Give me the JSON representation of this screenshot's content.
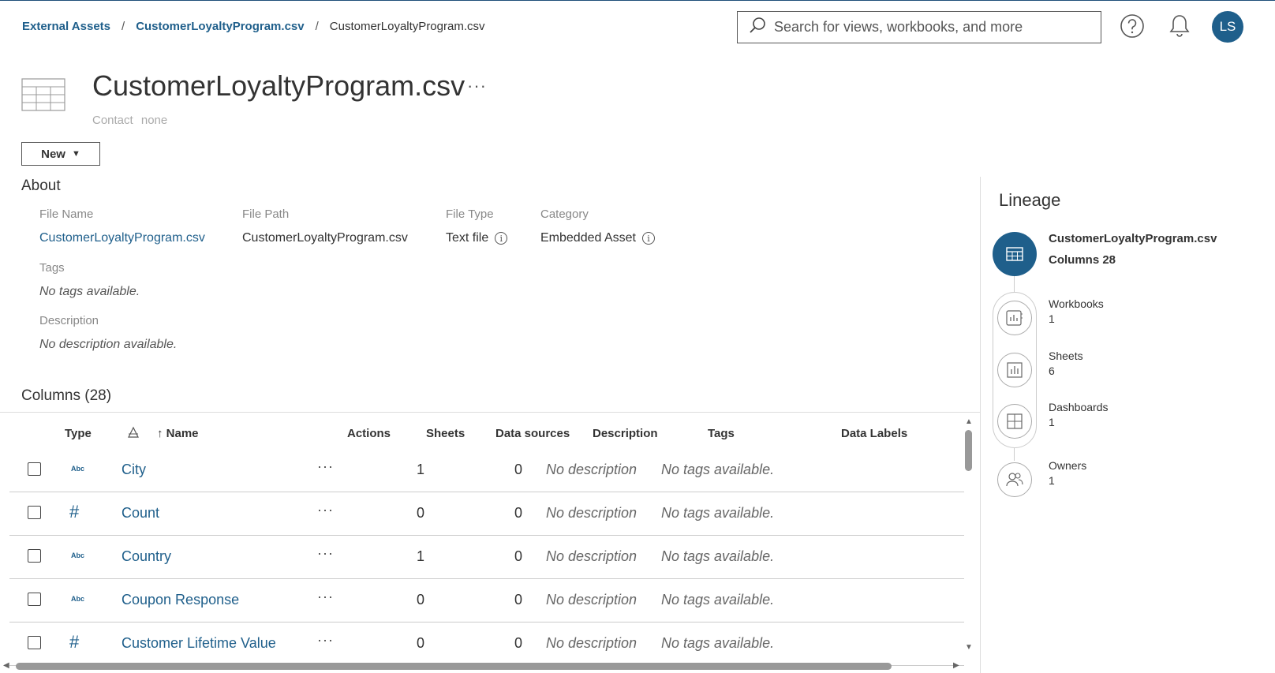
{
  "breadcrumb": {
    "items": [
      "External Assets",
      "CustomerLoyaltyProgram.csv"
    ],
    "current": "CustomerLoyaltyProgram.csv",
    "separator": "/"
  },
  "search": {
    "placeholder": "Search for views, workbooks, and more"
  },
  "user": {
    "initials": "LS"
  },
  "header": {
    "title": "CustomerLoyaltyProgram.csv",
    "more": "···",
    "contact_label": "Contact",
    "contact_value": "none",
    "new_button": "New",
    "new_caret": "▼"
  },
  "about": {
    "title": "About",
    "file_name_label": "File Name",
    "file_name": "CustomerLoyaltyProgram.csv",
    "file_path_label": "File Path",
    "file_path": "CustomerLoyaltyProgram.csv",
    "file_type_label": "File Type",
    "file_type": "Text file",
    "category_label": "Category",
    "category": "Embedded Asset",
    "tags_label": "Tags",
    "tags": "No tags available.",
    "description_label": "Description",
    "description": "No description available."
  },
  "columns": {
    "title": "Columns (28)",
    "headers": {
      "type": "Type",
      "name": "↑ Name",
      "actions": "Actions",
      "sheets": "Sheets",
      "data_sources": "Data sources",
      "description": "Description",
      "tags": "Tags",
      "data_labels": "Data Labels"
    },
    "rows": [
      {
        "type_glyph": "Abc",
        "kind": "text",
        "name": "City",
        "actions": "···",
        "sheets": "1",
        "data_sources": "0",
        "description": "No description",
        "tags": "No tags available."
      },
      {
        "type_glyph": "#",
        "kind": "number",
        "name": "Count",
        "actions": "···",
        "sheets": "0",
        "data_sources": "0",
        "description": "No description",
        "tags": "No tags available."
      },
      {
        "type_glyph": "Abc",
        "kind": "text",
        "name": "Country",
        "actions": "···",
        "sheets": "1",
        "data_sources": "0",
        "description": "No description",
        "tags": "No tags available."
      },
      {
        "type_glyph": "Abc",
        "kind": "text",
        "name": "Coupon Response",
        "actions": "···",
        "sheets": "0",
        "data_sources": "0",
        "description": "No description",
        "tags": "No tags available."
      },
      {
        "type_glyph": "#",
        "kind": "number",
        "name": "Customer Lifetime Value",
        "actions": "···",
        "sheets": "0",
        "data_sources": "0",
        "description": "No description",
        "tags": "No tags available."
      }
    ]
  },
  "lineage": {
    "title": "Lineage",
    "main_name": "CustomerLoyaltyProgram.csv",
    "main_sub": "Columns 28",
    "nodes": [
      {
        "label": "Workbooks",
        "count": "1",
        "icon": "workbook-icon"
      },
      {
        "label": "Sheets",
        "count": "6",
        "icon": "sheet-icon"
      },
      {
        "label": "Dashboards",
        "count": "1",
        "icon": "dashboard-icon"
      },
      {
        "label": "Owners",
        "count": "1",
        "icon": "owners-icon"
      }
    ]
  },
  "colors": {
    "accent": "#1f5f8b",
    "text": "#333333",
    "muted": "#888888"
  }
}
